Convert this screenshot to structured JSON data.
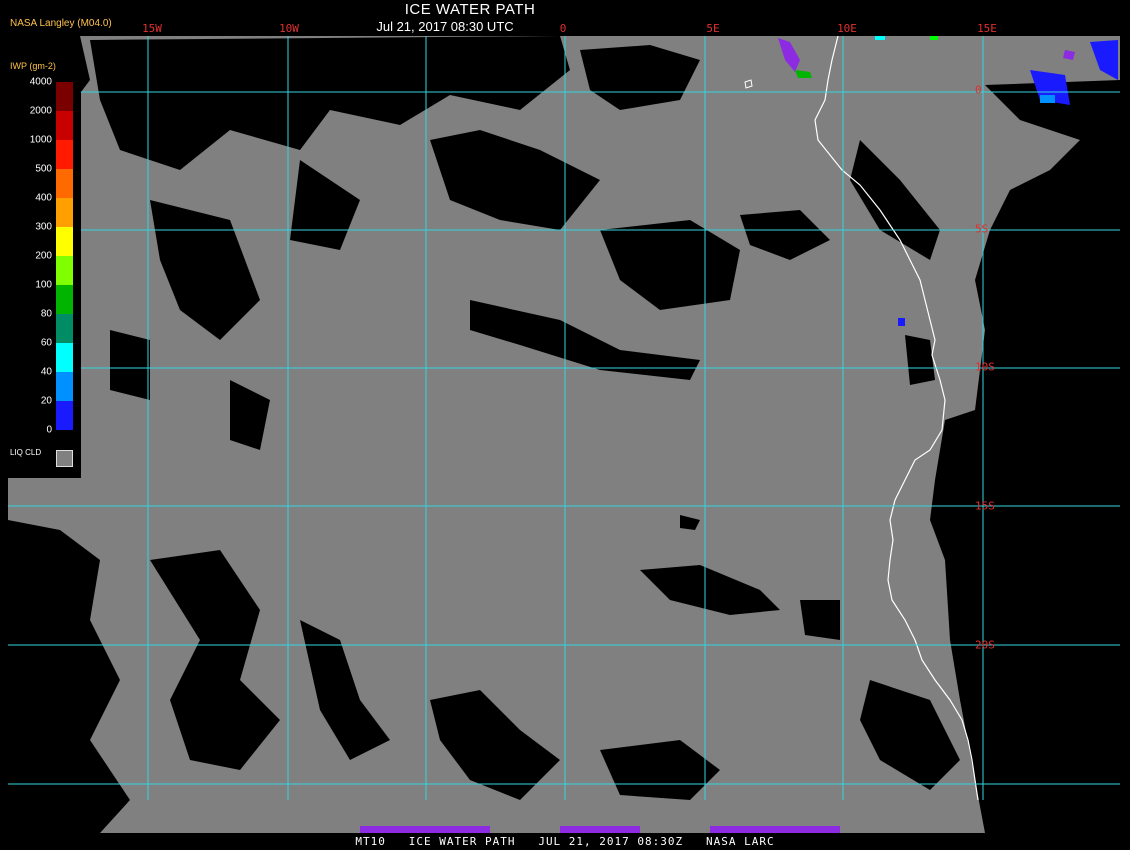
{
  "header": {
    "title": "ICE WATER PATH",
    "subtitle": "Jul 21, 2017 08:30 UTC",
    "agency": "NASA Langley (M04.0)"
  },
  "footer": "MT10   ICE WATER PATH   JUL 21, 2017 08:30Z   NASA LARC",
  "grid": {
    "longitude_labels": [
      "15W",
      "10W",
      "0",
      "5E",
      "10E",
      "15E"
    ],
    "latitude_labels": [
      "0",
      "5S",
      "10S",
      "15S",
      "20S"
    ],
    "line_color": "#33d6e0",
    "label_color": "#e03030"
  },
  "legend": {
    "units": "IWP (gm-2)",
    "levels": [
      {
        "label": "4000",
        "color": "#7a0000"
      },
      {
        "label": "2000",
        "color": "#c80000"
      },
      {
        "label": "1000",
        "color": "#ff1a00"
      },
      {
        "label": "500",
        "color": "#ff6a00"
      },
      {
        "label": "400",
        "color": "#ffa000"
      },
      {
        "label": "300",
        "color": "#ffff00"
      },
      {
        "label": "200",
        "color": "#80ff00"
      },
      {
        "label": "100",
        "color": "#00b400"
      },
      {
        "label": "80",
        "color": "#008c64"
      },
      {
        "label": "60",
        "color": "#00ffff"
      },
      {
        "label": "40",
        "color": "#0090ff"
      },
      {
        "label": "20",
        "color": "#1a1aff"
      },
      {
        "label": "0",
        "color": "#8c2be2"
      }
    ],
    "liquid_cloud_label": "LIQ CLD",
    "liquid_cloud_color": "#808080"
  },
  "colors": {
    "background": "#000000",
    "liquid_cloud": "#808080",
    "coastline": "#ffffff"
  }
}
